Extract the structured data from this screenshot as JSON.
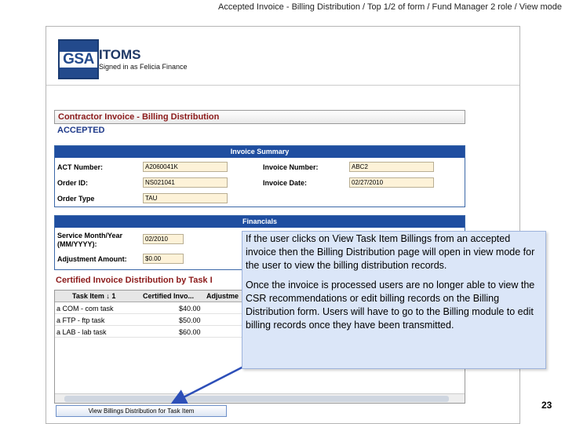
{
  "slide": {
    "title": "Accepted Invoice - Billing Distribution / Top 1/2 of form / Fund Manager 2 role / View mode",
    "page_number": "23"
  },
  "app": {
    "logo": "GSA",
    "name": "ITOMS",
    "signed_in": "Signed in as Felicia Finance"
  },
  "form": {
    "title": "Contractor Invoice - Billing Distribution",
    "status": "ACCEPTED"
  },
  "invoice_summary": {
    "header": "Invoice Summary",
    "act_number_label": "ACT Number:",
    "act_number": "A2060041K",
    "order_id_label": "Order ID:",
    "order_id": "NS021041",
    "order_type_label": "Order Type",
    "order_type": "TAU",
    "invoice_number_label": "Invoice Number:",
    "invoice_number": "ABC2",
    "invoice_date_label": "Invoice Date:",
    "invoice_date": "02/27/2010"
  },
  "financials": {
    "header": "Financials",
    "service_month_label_1": "Service Month/Year",
    "service_month_label_2": "(MM/YYYY):",
    "service_month": "02/2010",
    "adjustment_label": "Adjustment Amount:",
    "adjustment": "$0.00"
  },
  "certified": {
    "title": "Certified Invoice Distribution by Task I",
    "columns": [
      "Task Item ↓ 1",
      "Certified Invo...",
      "Adjustme"
    ],
    "rows": [
      {
        "task": "a COM - com task",
        "certified": "$40.00",
        "adjust": "$"
      },
      {
        "task": "a FTP - ftp task",
        "certified": "$50.00",
        "adjust": "$"
      },
      {
        "task": "a LAB - lab task",
        "certified": "$60.00",
        "adjust": "$"
      }
    ]
  },
  "view_button": "View Billings Distribution for Task Item",
  "callout": {
    "p1": "If the user clicks on View Task Item Billings from an accepted invoice then the Billing Distribution page will open in view mode for the user to view the billing distribution records.",
    "p2": "Once the invoice is processed users are no longer able to view the CSR recommendations or edit billing records on the Billing Distribution form.  Users will have to go to the Billing module to edit billing records once they have been transmitted."
  }
}
